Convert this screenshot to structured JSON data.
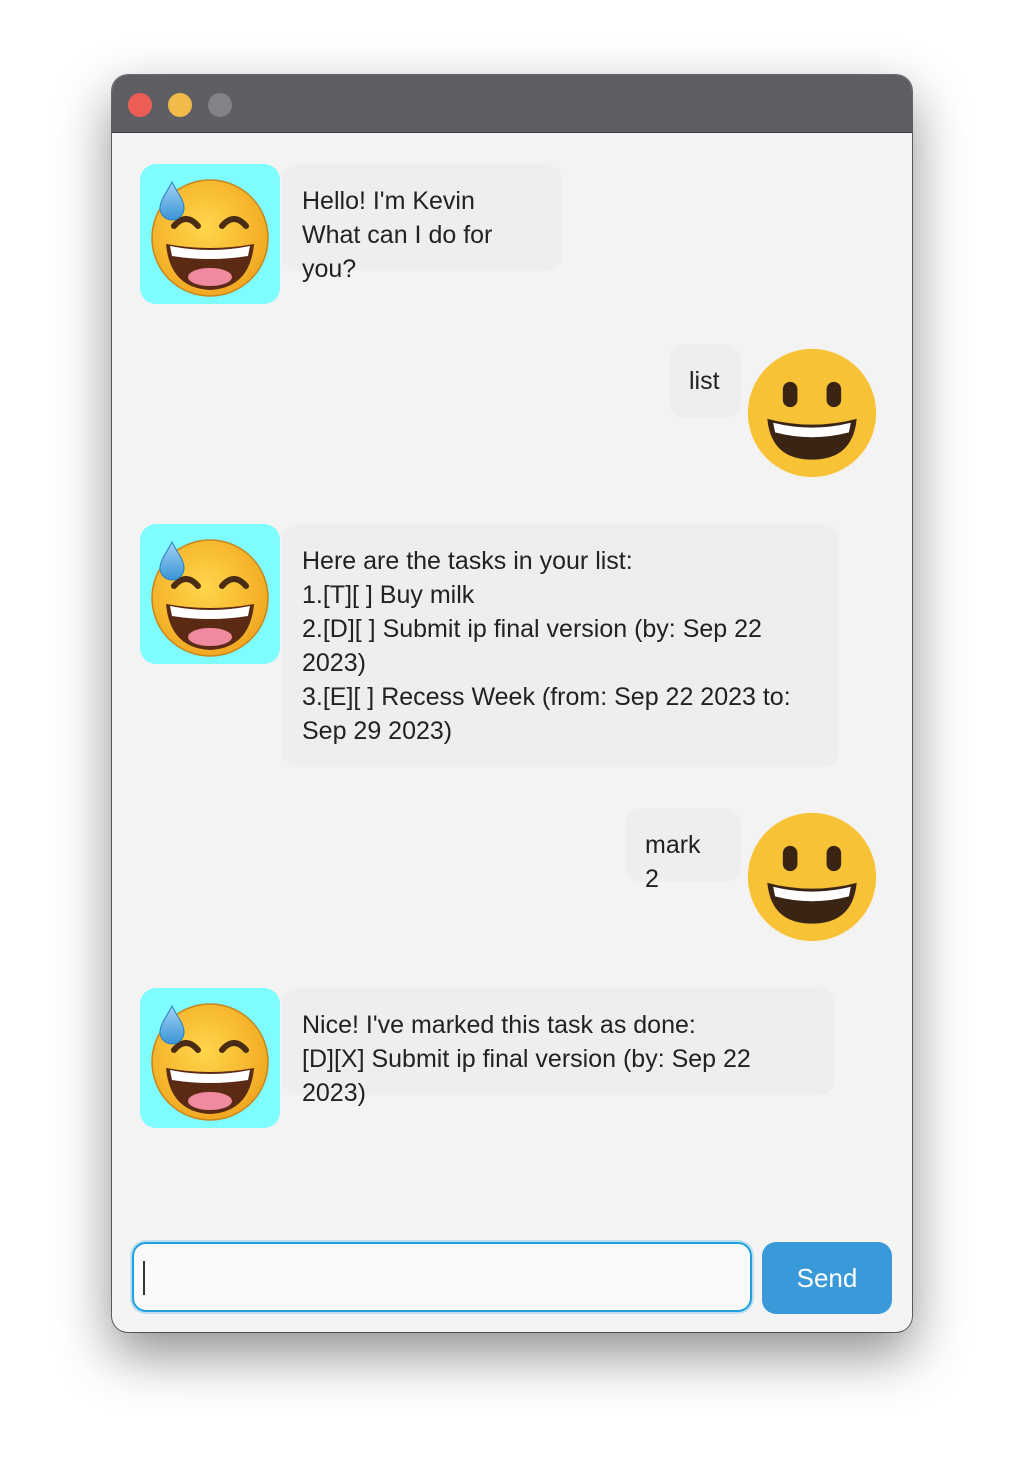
{
  "window": {
    "buttons": [
      "close",
      "minimize",
      "maximize"
    ]
  },
  "messages": [
    {
      "sender": "bot",
      "avatar": "grinning-sweat-emoji-icon",
      "text": "Hello! I'm Kevin\nWhat can I do for you?"
    },
    {
      "sender": "user",
      "avatar": "smiling-emoji-icon",
      "text": "list"
    },
    {
      "sender": "bot",
      "avatar": "grinning-sweat-emoji-icon",
      "text": "Here are the tasks in your list:\n1.[T][ ] Buy milk\n2.[D][ ] Submit ip final version (by: Sep 22\n2023)\n3.[E][ ] Recess Week (from: Sep 22 2023 to:\nSep 29 2023)"
    },
    {
      "sender": "user",
      "avatar": "smiling-emoji-icon",
      "text": "mark 2"
    },
    {
      "sender": "bot",
      "avatar": "grinning-sweat-emoji-icon",
      "text": "Nice! I've marked this task as done:\n[D][X] Submit ip final version (by: Sep 22 2023)"
    }
  ],
  "input": {
    "value": "",
    "placeholder": ""
  },
  "send_button": {
    "label": "Send"
  },
  "colors": {
    "titlebar": "#5f5e63",
    "bot_avatar_bg": "#7ffcff",
    "bubble_bg": "#eceeef",
    "send_bg": "#3a9ad9",
    "input_border": "#1ea0e0"
  }
}
